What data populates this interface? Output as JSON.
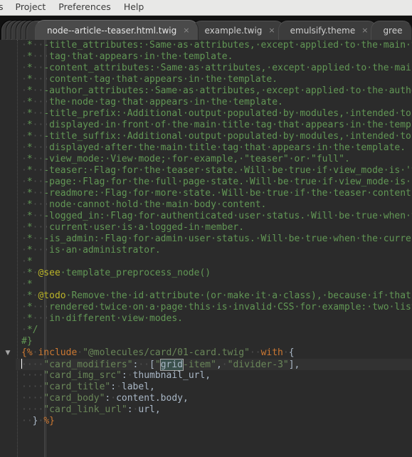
{
  "menubar": {
    "items": [
      {
        "label": "s",
        "clipped": true
      },
      {
        "label": "Project",
        "clipped": false
      },
      {
        "label": "Preferences",
        "clipped": false
      },
      {
        "label": "Help",
        "clipped": false
      }
    ]
  },
  "tabs": {
    "close_glyph": "×",
    "items": [
      {
        "label": "node--article--teaser.html.twig",
        "active": true
      },
      {
        "label": "example.twig",
        "active": false
      },
      {
        "label": "emulsify.theme",
        "active": false
      },
      {
        "label": "gree",
        "active": false,
        "partial": true
      }
    ]
  },
  "editor": {
    "fold_glyph": "▼",
    "caret_line_index": 28,
    "selection_text": "grid",
    "colors": {
      "background": "#2b2b2b",
      "highlight_line": "#323232",
      "doc_comment": "#629755",
      "comment": "#808080",
      "string": "#6a8759",
      "keyword": "#cc7832",
      "text": "#a9b7c6",
      "whitespace_dot": "#4e4e4e",
      "selection": "#3b514d"
    },
    "lines": [
      {
        "indent_guides": 1,
        "segments": [
          {
            "c": "ws",
            "t": "·"
          },
          {
            "c": "doc",
            "t": "*"
          },
          {
            "c": "ws",
            "t": "··"
          },
          {
            "c": "doc",
            "t": "-"
          },
          {
            "c": "gap",
            "t": ""
          },
          {
            "c": "doc",
            "t": "title_attributes:·Same·as·attributes,·except·applied·to·the·main·title"
          }
        ]
      },
      {
        "indent_guides": 1,
        "segments": [
          {
            "c": "ws",
            "t": "·"
          },
          {
            "c": "doc",
            "t": "*"
          },
          {
            "c": "ws",
            "t": "···"
          },
          {
            "c": "gap",
            "t": ""
          },
          {
            "c": "doc",
            "t": "tag·that·appears·in·the·template."
          }
        ]
      },
      {
        "indent_guides": 1,
        "segments": [
          {
            "c": "ws",
            "t": "·"
          },
          {
            "c": "doc",
            "t": "*"
          },
          {
            "c": "ws",
            "t": "··"
          },
          {
            "c": "doc",
            "t": "-"
          },
          {
            "c": "gap",
            "t": ""
          },
          {
            "c": "doc",
            "t": "content_attributes:·Same·as·attributes,·except·applied·to·the·main"
          }
        ]
      },
      {
        "indent_guides": 1,
        "segments": [
          {
            "c": "ws",
            "t": "·"
          },
          {
            "c": "doc",
            "t": "*"
          },
          {
            "c": "ws",
            "t": "···"
          },
          {
            "c": "gap",
            "t": ""
          },
          {
            "c": "doc",
            "t": "content·tag·that·appears·in·the·template."
          }
        ]
      },
      {
        "indent_guides": 1,
        "segments": [
          {
            "c": "ws",
            "t": "·"
          },
          {
            "c": "doc",
            "t": "*"
          },
          {
            "c": "ws",
            "t": "··"
          },
          {
            "c": "doc",
            "t": "-"
          },
          {
            "c": "gap",
            "t": ""
          },
          {
            "c": "doc",
            "t": "author_attributes:·Same·as·attributes,·except·applied·to·the·author"
          }
        ]
      },
      {
        "indent_guides": 1,
        "segments": [
          {
            "c": "ws",
            "t": "·"
          },
          {
            "c": "doc",
            "t": "*"
          },
          {
            "c": "ws",
            "t": "···"
          },
          {
            "c": "gap",
            "t": ""
          },
          {
            "c": "doc",
            "t": "the·node·tag·that·appears·in·the·template."
          }
        ]
      },
      {
        "indent_guides": 1,
        "segments": [
          {
            "c": "ws",
            "t": "·"
          },
          {
            "c": "doc",
            "t": "*"
          },
          {
            "c": "ws",
            "t": "··"
          },
          {
            "c": "doc",
            "t": "-"
          },
          {
            "c": "gap",
            "t": ""
          },
          {
            "c": "doc",
            "t": "title_prefix:·Additional·output·populated·by·modules,·intended·to·be"
          }
        ]
      },
      {
        "indent_guides": 1,
        "segments": [
          {
            "c": "ws",
            "t": "·"
          },
          {
            "c": "doc",
            "t": "*"
          },
          {
            "c": "ws",
            "t": "···"
          },
          {
            "c": "gap",
            "t": ""
          },
          {
            "c": "doc",
            "t": "displayed·in·front·of·the·main·title·tag·that·appears·in·the·template."
          }
        ]
      },
      {
        "indent_guides": 1,
        "segments": [
          {
            "c": "ws",
            "t": "·"
          },
          {
            "c": "doc",
            "t": "*"
          },
          {
            "c": "ws",
            "t": "··"
          },
          {
            "c": "doc",
            "t": "-"
          },
          {
            "c": "gap",
            "t": ""
          },
          {
            "c": "doc",
            "t": "title_suffix:·Additional·output·populated·by·modules,·intended·to·be"
          }
        ]
      },
      {
        "indent_guides": 1,
        "segments": [
          {
            "c": "ws",
            "t": "·"
          },
          {
            "c": "doc",
            "t": "*"
          },
          {
            "c": "ws",
            "t": "···"
          },
          {
            "c": "gap",
            "t": ""
          },
          {
            "c": "doc",
            "t": "displayed·after·the·main·title·tag·that·appears·in·the·template."
          }
        ]
      },
      {
        "indent_guides": 1,
        "segments": [
          {
            "c": "ws",
            "t": "·"
          },
          {
            "c": "doc",
            "t": "*"
          },
          {
            "c": "ws",
            "t": "··"
          },
          {
            "c": "doc",
            "t": "-"
          },
          {
            "c": "gap",
            "t": ""
          },
          {
            "c": "doc",
            "t": "view_mode:·View·mode;·for·example,·\"teaser\"·or·\"full\"."
          }
        ]
      },
      {
        "indent_guides": 1,
        "segments": [
          {
            "c": "ws",
            "t": "·"
          },
          {
            "c": "doc",
            "t": "*"
          },
          {
            "c": "ws",
            "t": "··"
          },
          {
            "c": "doc",
            "t": "-"
          },
          {
            "c": "gap",
            "t": ""
          },
          {
            "c": "doc",
            "t": "teaser:·Flag·for·the·teaser·state.·Will·be·true·if·view_mode·is·'te"
          }
        ]
      },
      {
        "indent_guides": 1,
        "segments": [
          {
            "c": "ws",
            "t": "·"
          },
          {
            "c": "doc",
            "t": "*"
          },
          {
            "c": "ws",
            "t": "··"
          },
          {
            "c": "doc",
            "t": "-"
          },
          {
            "c": "gap",
            "t": ""
          },
          {
            "c": "doc",
            "t": "page:·Flag·for·the·full·page·state.·Will·be·true·if·view_mode·is·'f"
          }
        ]
      },
      {
        "indent_guides": 1,
        "segments": [
          {
            "c": "ws",
            "t": "·"
          },
          {
            "c": "doc",
            "t": "*"
          },
          {
            "c": "ws",
            "t": "··"
          },
          {
            "c": "doc",
            "t": "-"
          },
          {
            "c": "gap",
            "t": ""
          },
          {
            "c": "doc",
            "t": "readmore:·Flag·for·more·state.·Will·be·true·if·the·teaser·content·o"
          }
        ]
      },
      {
        "indent_guides": 1,
        "segments": [
          {
            "c": "ws",
            "t": "·"
          },
          {
            "c": "doc",
            "t": "*"
          },
          {
            "c": "ws",
            "t": "···"
          },
          {
            "c": "gap",
            "t": ""
          },
          {
            "c": "doc",
            "t": "node·cannot·hold·the·main·body·content."
          }
        ]
      },
      {
        "indent_guides": 1,
        "segments": [
          {
            "c": "ws",
            "t": "·"
          },
          {
            "c": "doc",
            "t": "*"
          },
          {
            "c": "ws",
            "t": "··"
          },
          {
            "c": "doc",
            "t": "-"
          },
          {
            "c": "gap",
            "t": ""
          },
          {
            "c": "doc",
            "t": "logged_in:·Flag·for·authenticated·user·status.·Will·be·true·when·the"
          }
        ]
      },
      {
        "indent_guides": 1,
        "segments": [
          {
            "c": "ws",
            "t": "·"
          },
          {
            "c": "doc",
            "t": "*"
          },
          {
            "c": "ws",
            "t": "···"
          },
          {
            "c": "gap",
            "t": ""
          },
          {
            "c": "doc",
            "t": "current·user·is·a·logged-in·member."
          }
        ]
      },
      {
        "indent_guides": 1,
        "segments": [
          {
            "c": "ws",
            "t": "·"
          },
          {
            "c": "doc",
            "t": "*"
          },
          {
            "c": "ws",
            "t": "··"
          },
          {
            "c": "doc",
            "t": "-"
          },
          {
            "c": "gap",
            "t": ""
          },
          {
            "c": "doc",
            "t": "is_admin:·Flag·for·admin·user·status.·Will·be·true·when·the·current·u"
          }
        ]
      },
      {
        "indent_guides": 1,
        "segments": [
          {
            "c": "ws",
            "t": "·"
          },
          {
            "c": "doc",
            "t": "*"
          },
          {
            "c": "ws",
            "t": "···"
          },
          {
            "c": "gap",
            "t": ""
          },
          {
            "c": "doc",
            "t": "is·an·administrator."
          }
        ]
      },
      {
        "indent_guides": 1,
        "segments": [
          {
            "c": "ws",
            "t": "·"
          },
          {
            "c": "doc",
            "t": "*"
          }
        ]
      },
      {
        "indent_guides": 1,
        "segments": [
          {
            "c": "ws",
            "t": "·"
          },
          {
            "c": "doc",
            "t": "*"
          },
          {
            "c": "ws",
            "t": "·"
          },
          {
            "c": "tag",
            "t": "@see"
          },
          {
            "c": "doc",
            "t": "·template_preprocess_node()"
          }
        ]
      },
      {
        "indent_guides": 1,
        "segments": [
          {
            "c": "ws",
            "t": "·"
          },
          {
            "c": "doc",
            "t": "*"
          }
        ]
      },
      {
        "indent_guides": 1,
        "segments": [
          {
            "c": "ws",
            "t": "·"
          },
          {
            "c": "doc",
            "t": "*"
          },
          {
            "c": "ws",
            "t": "·"
          },
          {
            "c": "tag",
            "t": "@todo"
          },
          {
            "c": "doc",
            "t": "·Remove·the·id·attribute·(or·make·it·a·class),·because·if·that·is"
          }
        ]
      },
      {
        "indent_guides": 1,
        "segments": [
          {
            "c": "ws",
            "t": "·"
          },
          {
            "c": "doc",
            "t": "*"
          },
          {
            "c": "ws",
            "t": "···"
          },
          {
            "c": "gap",
            "t": ""
          },
          {
            "c": "doc",
            "t": "rendered·twice·on·a·page·this·is·invalid·CSS·for·example:·two·lists"
          }
        ]
      },
      {
        "indent_guides": 1,
        "segments": [
          {
            "c": "ws",
            "t": "·"
          },
          {
            "c": "doc",
            "t": "*"
          },
          {
            "c": "ws",
            "t": "···"
          },
          {
            "c": "gap",
            "t": ""
          },
          {
            "c": "doc",
            "t": "in·different·view·modes."
          }
        ]
      },
      {
        "indent_guides": 1,
        "segments": [
          {
            "c": "ws",
            "t": "·"
          },
          {
            "c": "doc",
            "t": "*/"
          }
        ]
      },
      {
        "indent_guides": 0,
        "segments": [
          {
            "c": "doc",
            "t": "#}"
          }
        ]
      },
      {
        "indent_guides": 0,
        "fold": true,
        "segments": [
          {
            "c": "twig",
            "t": "{%"
          },
          {
            "c": "ws",
            "t": "·"
          },
          {
            "c": "twig",
            "t": "include"
          },
          {
            "c": "ws",
            "t": "·"
          },
          {
            "c": "str",
            "t": "\"@molecules/card/01-card.twig\""
          },
          {
            "c": "ws",
            "t": "··"
          },
          {
            "c": "twig",
            "t": "with"
          },
          {
            "c": "ws",
            "t": "·"
          },
          {
            "c": "plain",
            "t": "{"
          }
        ]
      },
      {
        "indent_guides": 1,
        "highlight": true,
        "caret": true,
        "segments": [
          {
            "c": "ws",
            "t": "····"
          },
          {
            "c": "gap",
            "t": ""
          },
          {
            "c": "str",
            "t": "\"card_modifiers\""
          },
          {
            "c": "plain",
            "t": ":"
          },
          {
            "c": "ws",
            "t": "··"
          },
          {
            "c": "plain",
            "t": "["
          },
          {
            "c": "str",
            "t": "\""
          },
          {
            "c": "sel",
            "t": "grid"
          },
          {
            "c": "str",
            "t": "-item\""
          },
          {
            "c": "plain",
            "t": ","
          },
          {
            "c": "ws",
            "t": "·"
          },
          {
            "c": "str",
            "t": "\"divider-3\""
          },
          {
            "c": "plain",
            "t": "],"
          }
        ]
      },
      {
        "indent_guides": 1,
        "segments": [
          {
            "c": "ws",
            "t": "····"
          },
          {
            "c": "gap",
            "t": ""
          },
          {
            "c": "str",
            "t": "\"card_img_src\""
          },
          {
            "c": "plain",
            "t": ":"
          },
          {
            "c": "ws",
            "t": "·"
          },
          {
            "c": "plain",
            "t": "thumbnail_url,"
          }
        ]
      },
      {
        "indent_guides": 1,
        "segments": [
          {
            "c": "ws",
            "t": "····"
          },
          {
            "c": "gap",
            "t": ""
          },
          {
            "c": "str",
            "t": "\"card_title\""
          },
          {
            "c": "plain",
            "t": ":"
          },
          {
            "c": "ws",
            "t": "·"
          },
          {
            "c": "plain",
            "t": "label,"
          }
        ]
      },
      {
        "indent_guides": 1,
        "segments": [
          {
            "c": "ws",
            "t": "····"
          },
          {
            "c": "gap",
            "t": ""
          },
          {
            "c": "str",
            "t": "\"card_body\""
          },
          {
            "c": "plain",
            "t": ":"
          },
          {
            "c": "ws",
            "t": "·"
          },
          {
            "c": "plain",
            "t": "content.body,"
          }
        ]
      },
      {
        "indent_guides": 1,
        "segments": [
          {
            "c": "ws",
            "t": "····"
          },
          {
            "c": "gap",
            "t": ""
          },
          {
            "c": "str",
            "t": "\"card_link_url\""
          },
          {
            "c": "plain",
            "t": ":"
          },
          {
            "c": "ws",
            "t": "·"
          },
          {
            "c": "plain",
            "t": "url,"
          }
        ]
      },
      {
        "indent_guides": 1,
        "segments": [
          {
            "c": "ws",
            "t": "··"
          },
          {
            "c": "plain",
            "t": "}"
          },
          {
            "c": "ws",
            "t": "·"
          },
          {
            "c": "twig",
            "t": "%}"
          }
        ]
      }
    ]
  }
}
